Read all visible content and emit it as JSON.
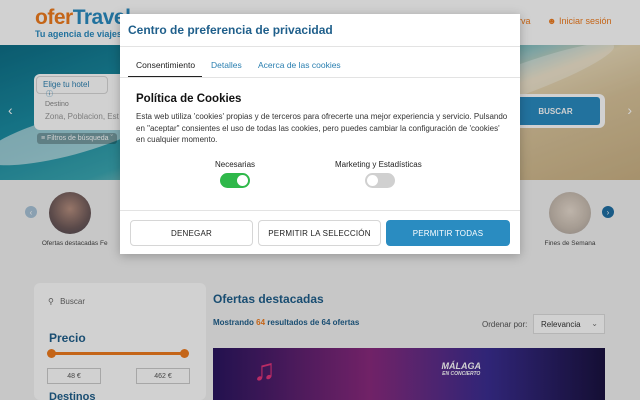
{
  "header": {
    "logo_main_1": "ofer",
    "logo_main_2": "Travel",
    "logo_tagline": "Tu agencia de viajes",
    "link_reserva": "rva",
    "link_login": "Iniciar sesión",
    "user_icon": "user-icon"
  },
  "search": {
    "tab_hotel": "Elige tu hotel",
    "dest_label": "Destino",
    "dest_placeholder": "Zona, Poblacion, Est",
    "filters_label": "Filtros de búsqueda",
    "search_button": "BUSCAR"
  },
  "categories": [
    {
      "label": "Ofertas destacadas"
    },
    {
      "label": "Fe"
    },
    {
      "label": "Fines de Semana"
    }
  ],
  "sidebar": {
    "search_placeholder": "Buscar",
    "price_title": "Precio",
    "price_min": "48 €",
    "price_max": "462 €",
    "destinations_title": "Destinos"
  },
  "main": {
    "title": "Ofertas destacadas",
    "results_prefix": "Mostrando",
    "results_count": "64",
    "results_suffix": "resultados de 64 ofertas",
    "order_label": "Ordenar por:",
    "order_value": "Relevancia",
    "promo_line1": "MÁLAGA",
    "promo_line2": "EN CONCIERTO"
  },
  "modal": {
    "title": "Centro de preferencia de privacidad",
    "tabs": [
      "Consentimiento",
      "Detalles",
      "Acerca de las cookies"
    ],
    "heading": "Política de Cookies",
    "body": "Esta web utiliza 'cookies' propias y de terceros para ofrecerte una mejor experiencia y servicio. Pulsando en \"aceptar\" consientes el uso de todas las cookies, pero puedes cambiar la configuración de 'cookies' en cualquier momento.",
    "toggle_necessary_label": "Necesarias",
    "toggle_necessary_on": true,
    "toggle_marketing_label": "Marketing y Estadísticas",
    "toggle_marketing_on": false,
    "btn_deny": "DENEGAR",
    "btn_allow_selection": "PERMITIR LA SELECCIÓN",
    "btn_allow_all": "PERMITIR TODAS"
  },
  "colors": {
    "brand_orange": "#f07c1e",
    "brand_blue": "#2a8cc1",
    "toggle_on": "#2fb84a",
    "toggle_off": "#d0d0d0"
  }
}
